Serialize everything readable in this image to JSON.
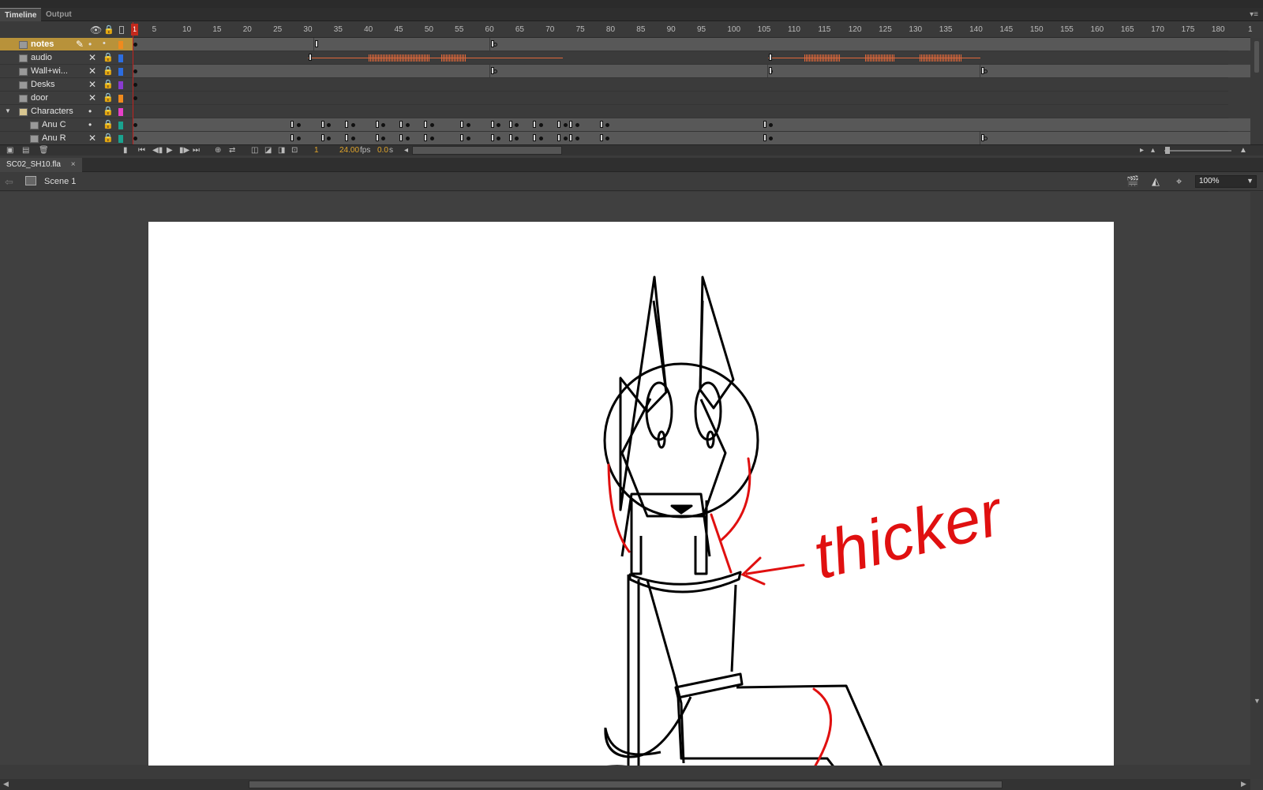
{
  "panel": {
    "tabs": [
      {
        "label": "Timeline"
      },
      {
        "label": "Output"
      }
    ],
    "menu_icon": "panel-menu-icon"
  },
  "ruler": {
    "current_frame": "1",
    "ticks": [
      "5",
      "10",
      "15",
      "20",
      "25",
      "30",
      "35",
      "40",
      "45",
      "50",
      "55",
      "60",
      "65",
      "70",
      "75",
      "80",
      "85",
      "90",
      "95",
      "100",
      "105",
      "110",
      "115",
      "120",
      "125",
      "130",
      "135",
      "140",
      "145",
      "150",
      "155",
      "160",
      "165",
      "170",
      "175",
      "180",
      "1"
    ]
  },
  "layers": [
    {
      "name": "notes",
      "selected": true,
      "color": "#f08a1d",
      "vis_icon": "pencil-icon"
    },
    {
      "name": "audio",
      "selected": false,
      "color": "#2c6de0"
    },
    {
      "name": "Wall+wi...",
      "selected": false,
      "color": "#2c6de0"
    },
    {
      "name": "Desks",
      "selected": false,
      "color": "#8a3bd0"
    },
    {
      "name": "door",
      "selected": false,
      "color": "#f08a1d"
    },
    {
      "name": "Characters",
      "selected": false,
      "color": "#e640c8",
      "folder": true
    },
    {
      "name": "Anu C",
      "selected": false,
      "color": "#1aa38f"
    },
    {
      "name": "Anu R",
      "selected": false,
      "color": "#1aa38f"
    }
  ],
  "footer": {
    "frame": "1",
    "fps": "24.00",
    "fps_unit": "fps",
    "time": "0.0",
    "time_unit": "s"
  },
  "document": {
    "tab": "SC02_SH10.fla",
    "close": "×",
    "scene": "Scene 1",
    "zoom": "100%"
  },
  "stage": {
    "annotation": "thicker"
  },
  "colors": {
    "accent_selected_layer": "#b8923a",
    "playhead": "#c42b1c",
    "waveform": "#e0683a",
    "annotation": "#e01010"
  }
}
